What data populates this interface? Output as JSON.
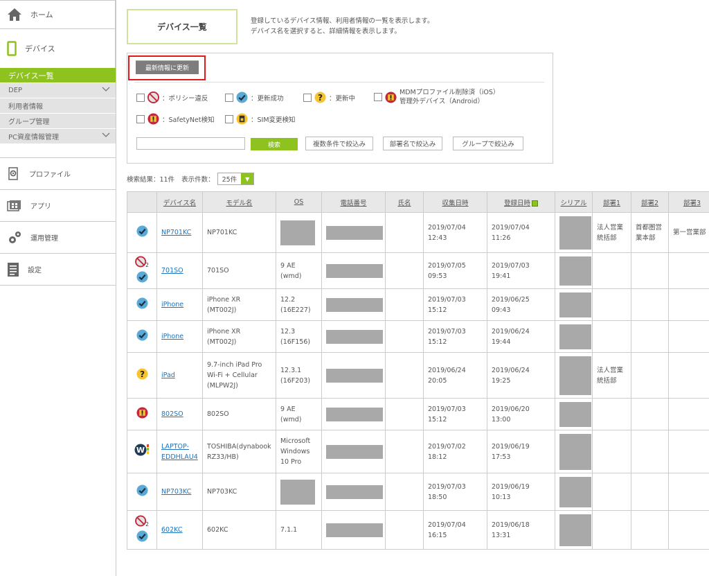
{
  "sidebar": {
    "home": "ホーム",
    "device": "デバイス",
    "subitems": [
      {
        "label": "デバイス一覧",
        "active": true
      },
      {
        "label": "DEP",
        "has_chevron": true
      },
      {
        "label": "利用者情報"
      },
      {
        "label": "グループ管理"
      },
      {
        "label": "PC資産情報管理",
        "has_chevron": true
      }
    ],
    "profile": "プロファイル",
    "app": "アプリ",
    "operation": "運用管理",
    "settings": "設定"
  },
  "header": {
    "title": "デバイス一覧",
    "desc_line1": "登録しているデバイス情報、利用者情報の一覧を表示します。",
    "desc_line2": "デバイス名を選択すると、詳細情報を表示します。"
  },
  "panel": {
    "refresh_label": "最新情報に更新",
    "legend": {
      "policy": "：ポリシー違反",
      "success": "：更新成功",
      "updating": "：更新中",
      "mdm_line1": "MDMプロファイル削除済（iOS）",
      "mdm_line2": "管理外デバイス（Android）",
      "safetynet": "：SafetyNet検知",
      "sim": "：SIM変更検知"
    },
    "search_value": "",
    "search_btn": "検索",
    "filter_conditions": "複数条件で絞込み",
    "filter_department": "部署名で絞込み",
    "filter_group": "グループで絞込み"
  },
  "results": {
    "count_label": "検索結果：11件",
    "per_page_label": "表示件数：",
    "per_page_value": "25件"
  },
  "table": {
    "columns": [
      "",
      "デバイス名",
      "モデル名",
      "OS",
      "電話番号",
      "氏名",
      "収集日時",
      "登録日時",
      "シリアル",
      "部署1",
      "部署2",
      "部署3"
    ],
    "rows": [
      {
        "status": [
          "check"
        ],
        "device": "NP701KC",
        "model": "NP701KC",
        "os": "",
        "os_masked": true,
        "collected": "2019/07/04 12:43",
        "registered": "2019/07/04 11:26",
        "dept1": "法人営業統括部",
        "dept2": "首都圏営業本部",
        "dept3": "第一営業部"
      },
      {
        "status": [
          "policy2",
          "check"
        ],
        "device": "701SO",
        "model": "701SO",
        "os": "9 AE (wmd)",
        "collected": "2019/07/05 09:53",
        "registered": "2019/07/03 19:41",
        "dept1": "",
        "dept2": "",
        "dept3": ""
      },
      {
        "status": [
          "check"
        ],
        "device": "iPhone",
        "model": "iPhone XR (MT002J)",
        "os": "12.2 (16E227)",
        "collected": "2019/07/03 15:12",
        "registered": "2019/06/25 09:43",
        "dept1": "",
        "dept2": "",
        "dept3": ""
      },
      {
        "status": [
          "check"
        ],
        "device": "iPhone",
        "model": "iPhone XR (MT002J)",
        "os": "12.3 (16F156)",
        "collected": "2019/07/03 15:12",
        "registered": "2019/06/24 19:44",
        "dept1": "",
        "dept2": "",
        "dept3": ""
      },
      {
        "status": [
          "question"
        ],
        "device": "iPad",
        "model": "9.7-inch iPad Pro Wi-Fi + Cellular (MLPW2J)",
        "os": "12.3.1 (16F203)",
        "collected": "2019/06/24 20:05",
        "registered": "2019/06/24 19:25",
        "dept1": "法人営業統括部",
        "dept2": "",
        "dept3": ""
      },
      {
        "status": [
          "alert"
        ],
        "device": "802SO",
        "model": "802SO",
        "os": "9 AE (wmd)",
        "collected": "2019/07/03 15:12",
        "registered": "2019/06/20 13:00",
        "dept1": "",
        "dept2": "",
        "dept3": ""
      },
      {
        "status": [
          "windows"
        ],
        "device": "LAPTOP-EDDHLAU4",
        "model": "TOSHIBA(dynabook RZ33/HB)",
        "os": "Microsoft Windows 10 Pro",
        "collected": "2019/07/02 18:12",
        "registered": "2019/06/19 17:53",
        "dept1": "",
        "dept2": "",
        "dept3": ""
      },
      {
        "status": [
          "check"
        ],
        "device": "NP703KC",
        "model": "NP703KC",
        "os": "",
        "os_masked": true,
        "collected": "2019/07/03 18:50",
        "registered": "2019/06/19 10:13",
        "dept1": "",
        "dept2": "",
        "dept3": ""
      },
      {
        "status": [
          "policy2",
          "check"
        ],
        "device": "602KC",
        "model": "602KC",
        "os": "7.1.1",
        "collected": "2019/07/04 16:15",
        "registered": "2019/06/18 13:31",
        "dept1": "",
        "dept2": "",
        "dept3": ""
      }
    ]
  },
  "colors": {
    "accent": "#8dc21f",
    "highlight_border": "#e0191d",
    "link": "#1e73be",
    "masked": "#a9a9a9"
  }
}
